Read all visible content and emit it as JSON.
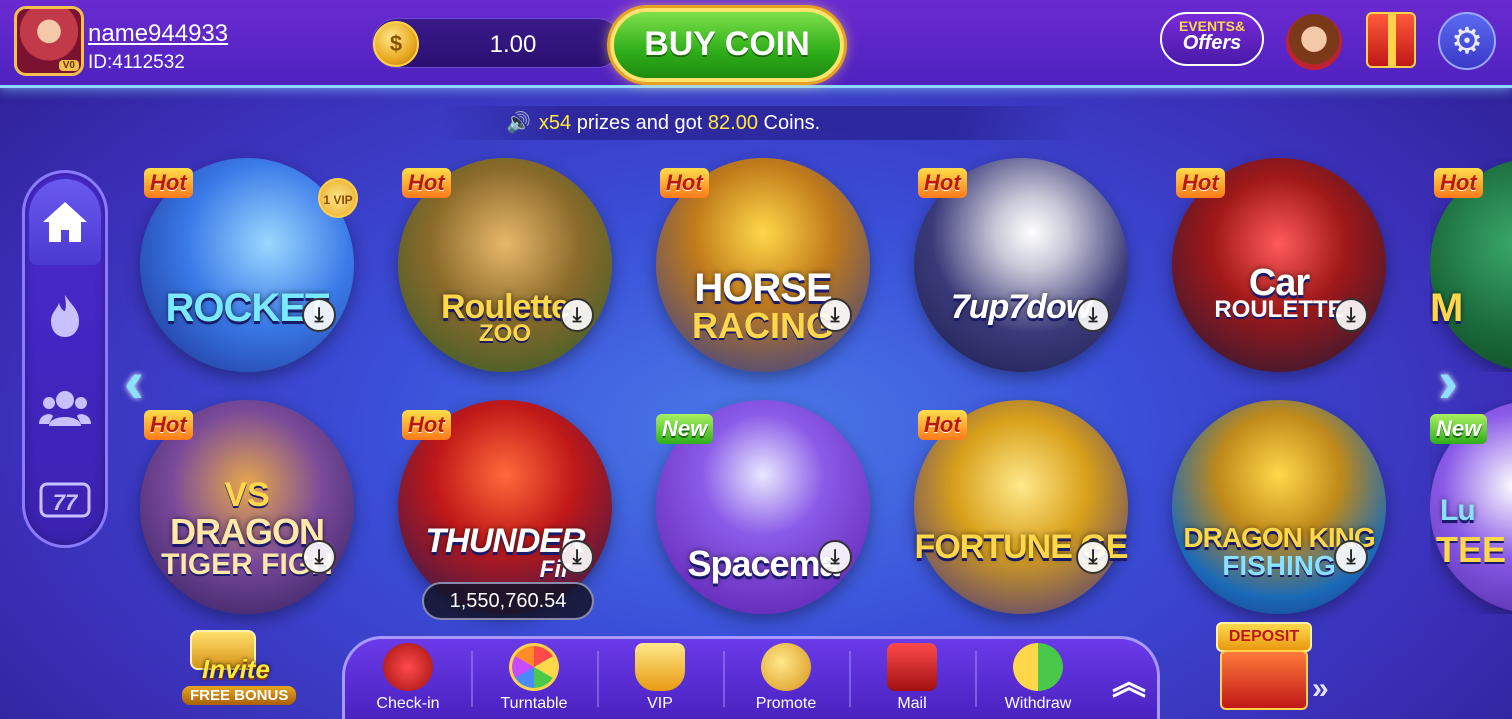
{
  "header": {
    "username": "name944933",
    "user_id": "ID:4112532",
    "avatar_badge": "V0",
    "balance": "1.00",
    "coin_symbol": "$",
    "buy_coin_label": "BUY COIN",
    "events_label": "EVENTS&",
    "offers_label": "Offers"
  },
  "marquee": {
    "part1": "x54",
    "part2": "prizes and got",
    "part3": "82.00",
    "part4": "Coins."
  },
  "sidenav": {
    "items": [
      {
        "icon": "home-icon"
      },
      {
        "icon": "fire-icon"
      },
      {
        "icon": "people-icon"
      },
      {
        "icon": "slots-777-icon"
      }
    ]
  },
  "games": [
    {
      "title": "ROCKET",
      "subtitle": "",
      "badge": "Hot",
      "vip": "1 VIP"
    },
    {
      "title": "Roulette",
      "subtitle": "ZOO",
      "badge": "Hot"
    },
    {
      "title": "HORSE",
      "subtitle": "RACING",
      "badge": "Hot"
    },
    {
      "title": "7up7dow",
      "subtitle": "",
      "badge": "Hot"
    },
    {
      "title": "Car",
      "subtitle": "ROULETTE",
      "badge": "Hot"
    },
    {
      "title": "M",
      "subtitle": "",
      "badge": "Hot"
    },
    {
      "title": "DRAGON",
      "subtitle": "TIGER FIGH",
      "badge": "Hot",
      "prefix": "VS"
    },
    {
      "title": "THUNDER",
      "subtitle": "Fir",
      "badge": "Hot"
    },
    {
      "title": "Spacema",
      "subtitle": "",
      "badge": "New"
    },
    {
      "title": "FORTUNE GE",
      "subtitle": "",
      "badge": "Hot"
    },
    {
      "title": "DRAGON KING",
      "subtitle": "FISHING",
      "badge": ""
    },
    {
      "title": "Lu",
      "subtitle": "TEE",
      "badge": "New"
    }
  ],
  "jackpot": "1,550,760.54",
  "invite": {
    "label": "Invite",
    "sub": "FREE BONUS"
  },
  "bottombar": {
    "items": [
      {
        "label": "Check-in"
      },
      {
        "label": "Turntable"
      },
      {
        "label": "VIP"
      },
      {
        "label": "Promote"
      },
      {
        "label": "Mail"
      },
      {
        "label": "Withdraw"
      }
    ]
  },
  "deposit": {
    "label": "DEPOSIT"
  },
  "colors": {
    "accent_green": "#2fae1a",
    "accent_gold": "#ffd24a",
    "background_blue": "#3a4fd8",
    "background_purple": "#4f22c0"
  }
}
